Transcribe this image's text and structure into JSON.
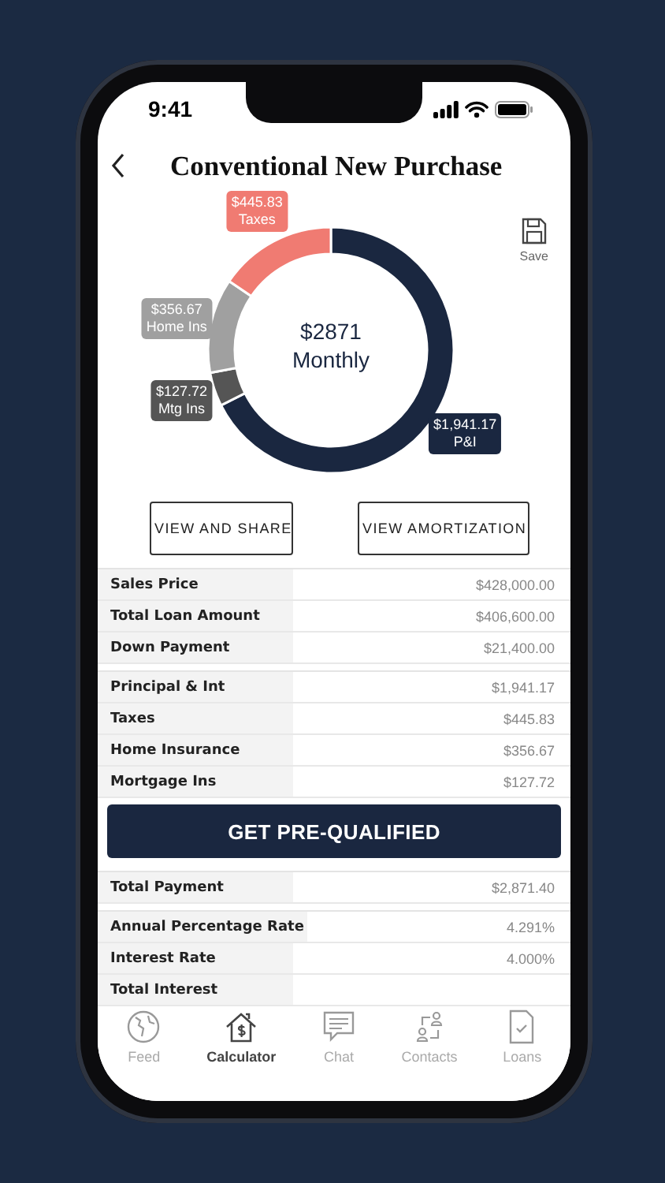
{
  "status_bar": {
    "time": "9:41"
  },
  "header": {
    "title": "Conventional New Purchase"
  },
  "summary": {
    "amount": "$2871",
    "period": "Monthly",
    "chart_data": {
      "type": "donut",
      "categories": [
        "P&I",
        "Mtg Ins",
        "Home Ins",
        "Taxes"
      ],
      "values": [
        1941.17,
        127.72,
        356.67,
        445.83
      ],
      "value_labels": [
        "$1,941.17",
        "$127.72",
        "$356.67",
        "$445.83"
      ]
    }
  },
  "save": {
    "label": "Save"
  },
  "actions": [
    "VIEW AND SHARE",
    "VIEW AMORTIZATION"
  ],
  "sections": [
    {
      "kind": "table",
      "rows": [
        {
          "label": "Sales Price",
          "value": "$428,000.00"
        },
        {
          "label": "Total Loan Amount",
          "value": "$406,600.00"
        },
        {
          "label": "Down Payment",
          "value": "$21,400.00"
        }
      ]
    },
    {
      "kind": "table",
      "rows": [
        {
          "label": "Principal & Int",
          "value": "$1,941.17"
        },
        {
          "label": "Taxes",
          "value": "$445.83"
        },
        {
          "label": "Home Insurance",
          "value": "$356.67"
        },
        {
          "label": "Mortgage Ins",
          "value": "$127.72"
        }
      ]
    },
    {
      "kind": "button",
      "label": "GET PRE-QUALIFIED"
    },
    {
      "kind": "table",
      "rows": [
        {
          "label": "Total Payment",
          "value": "$2,871.40"
        }
      ]
    },
    {
      "kind": "table",
      "rows": [
        {
          "label": "Annual Percentage Rate",
          "value": "4.291%"
        },
        {
          "label": "Interest Rate",
          "value": "4.000%"
        },
        {
          "label": "Total Interest"
        }
      ]
    }
  ],
  "tab_bar": [
    {
      "label": "Feed",
      "selected": false
    },
    {
      "label": "Calculator",
      "selected": true
    },
    {
      "label": "Chat",
      "selected": false
    },
    {
      "label": "Contacts",
      "selected": false
    },
    {
      "label": "Loans",
      "selected": false
    }
  ]
}
